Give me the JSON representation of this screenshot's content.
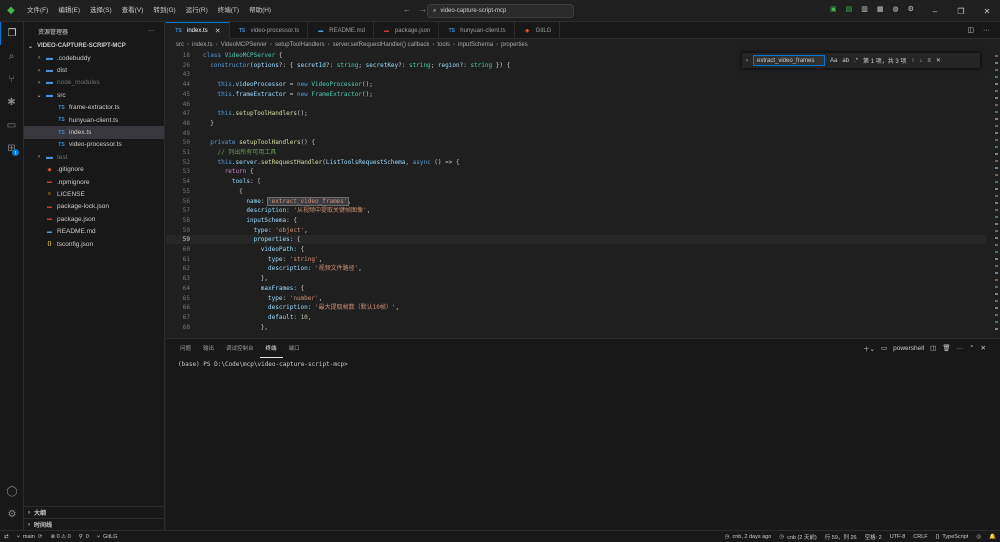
{
  "menu": [
    "文件(F)",
    "编辑(E)",
    "选择(S)",
    "查看(V)",
    "转到(G)",
    "运行(R)",
    "终端(T)",
    "帮助(H)"
  ],
  "search": {
    "value": "video-capture-script-mcp"
  },
  "sidebar": {
    "header": "资源管理器",
    "root": "VIDEO-CAPTURE-SCRIPT-MCP",
    "items": [
      {
        "label": ".codebuddy",
        "icon": "folder",
        "depth": 1,
        "chev": "›",
        "dim": false,
        "selected": false
      },
      {
        "label": "dist",
        "icon": "folder",
        "depth": 1,
        "chev": "›",
        "dim": false,
        "selected": false
      },
      {
        "label": "node_modules",
        "icon": "folder",
        "depth": 1,
        "chev": "›",
        "dim": true,
        "selected": false
      },
      {
        "label": "src",
        "icon": "folder",
        "depth": 1,
        "chev": "⌄",
        "dim": false,
        "selected": false
      },
      {
        "label": "frame-extractor.ts",
        "icon": "TS",
        "depth": 2,
        "chev": "",
        "dim": false,
        "selected": false
      },
      {
        "label": "hunyuan-client.ts",
        "icon": "TS",
        "depth": 2,
        "chev": "",
        "dim": false,
        "selected": false
      },
      {
        "label": "index.ts",
        "icon": "TS",
        "depth": 2,
        "chev": "",
        "dim": false,
        "selected": true
      },
      {
        "label": "video-processor.ts",
        "icon": "TS",
        "depth": 2,
        "chev": "",
        "dim": false,
        "selected": false
      },
      {
        "label": "test",
        "icon": "folder",
        "depth": 1,
        "chev": "›",
        "dim": true,
        "selected": false
      },
      {
        "label": ".gitignore",
        "icon": "git",
        "depth": 1,
        "chev": "",
        "dim": false,
        "selected": false
      },
      {
        "label": ".npmignore",
        "icon": "npm",
        "depth": 1,
        "chev": "",
        "dim": false,
        "selected": false
      },
      {
        "label": "LICENSE",
        "icon": "lic",
        "depth": 1,
        "chev": "",
        "dim": false,
        "selected": false
      },
      {
        "label": "package-lock.json",
        "icon": "json",
        "depth": 1,
        "chev": "",
        "dim": false,
        "selected": false
      },
      {
        "label": "package.json",
        "icon": "json",
        "depth": 1,
        "chev": "",
        "dim": false,
        "selected": false
      },
      {
        "label": "README.md",
        "icon": "md",
        "depth": 1,
        "chev": "",
        "dim": false,
        "selected": false
      },
      {
        "label": "tsconfig.json",
        "icon": "tsconfig",
        "depth": 1,
        "chev": "",
        "dim": false,
        "selected": false
      }
    ],
    "outline": "大纲",
    "timeline": "时间线"
  },
  "tabs": [
    {
      "label": "index.ts",
      "icon": "TS",
      "active": true
    },
    {
      "label": "video-processor.ts",
      "icon": "TS",
      "active": false
    },
    {
      "label": "README.md",
      "icon": "md",
      "active": false
    },
    {
      "label": "package.json",
      "icon": "json",
      "active": false
    },
    {
      "label": "hunyuan-client.ts",
      "icon": "TS",
      "active": false
    },
    {
      "label": "GitLG",
      "icon": "git",
      "active": false
    }
  ],
  "breadcrumb": [
    "src",
    "index.ts",
    "VideoMCPServer",
    "setupToolHandlers",
    "server.setRequestHandler() callback",
    "tools",
    "inputSchema",
    "properties"
  ],
  "find": {
    "value": "extract_video_frames",
    "result": "第 1 项，共 3 项"
  },
  "code": [
    {
      "n": "18",
      "cur": false,
      "toks": [
        [
          "class ",
          "kw"
        ],
        [
          "VideoMCPServer",
          "t"
        ],
        [
          " {",
          "p"
        ]
      ]
    },
    {
      "n": "26",
      "cur": false,
      "toks": [
        [
          "  ",
          "p"
        ],
        [
          "constructor",
          "kw"
        ],
        [
          "(",
          "p"
        ],
        [
          "options",
          "v"
        ],
        [
          "?: { ",
          "p"
        ],
        [
          "secretId",
          "v"
        ],
        [
          "?: ",
          "p"
        ],
        [
          "string",
          "t"
        ],
        [
          "; ",
          "p"
        ],
        [
          "secretKey",
          "v"
        ],
        [
          "?: ",
          "p"
        ],
        [
          "string",
          "t"
        ],
        [
          "; ",
          "p"
        ],
        [
          "region",
          "v"
        ],
        [
          "?: ",
          "p"
        ],
        [
          "string",
          "t"
        ],
        [
          " }) {",
          "p"
        ]
      ]
    },
    {
      "n": "43",
      "cur": false,
      "toks": [
        [
          "",
          "p"
        ]
      ]
    },
    {
      "n": "44",
      "cur": false,
      "toks": [
        [
          "    ",
          "p"
        ],
        [
          "this",
          "kw"
        ],
        [
          ".",
          "p"
        ],
        [
          "videoProcessor",
          "v"
        ],
        [
          " = ",
          "p"
        ],
        [
          "new ",
          "kw"
        ],
        [
          "VideoProcessor",
          "t"
        ],
        [
          "();",
          "p"
        ]
      ]
    },
    {
      "n": "45",
      "cur": false,
      "toks": [
        [
          "    ",
          "p"
        ],
        [
          "this",
          "kw"
        ],
        [
          ".",
          "p"
        ],
        [
          "frameExtractor",
          "v"
        ],
        [
          " = ",
          "p"
        ],
        [
          "new ",
          "kw"
        ],
        [
          "FrameExtractor",
          "t"
        ],
        [
          "();",
          "p"
        ]
      ]
    },
    {
      "n": "46",
      "cur": false,
      "toks": [
        [
          "",
          "p"
        ]
      ]
    },
    {
      "n": "47",
      "cur": false,
      "toks": [
        [
          "    ",
          "p"
        ],
        [
          "this",
          "kw"
        ],
        [
          ".",
          "p"
        ],
        [
          "setupToolHandlers",
          "f"
        ],
        [
          "();",
          "p"
        ]
      ]
    },
    {
      "n": "48",
      "cur": false,
      "toks": [
        [
          "  }",
          "p"
        ]
      ]
    },
    {
      "n": "49",
      "cur": false,
      "toks": [
        [
          "",
          "p"
        ]
      ]
    },
    {
      "n": "50",
      "cur": false,
      "toks": [
        [
          "  ",
          "p"
        ],
        [
          "private ",
          "kw"
        ],
        [
          "setupToolHandlers",
          "f"
        ],
        [
          "() {",
          "p"
        ]
      ]
    },
    {
      "n": "51",
      "cur": false,
      "toks": [
        [
          "    ",
          "p"
        ],
        [
          "// 列出所有可用工具",
          "c"
        ]
      ]
    },
    {
      "n": "52",
      "cur": false,
      "toks": [
        [
          "    ",
          "p"
        ],
        [
          "this",
          "kw"
        ],
        [
          ".",
          "p"
        ],
        [
          "server",
          "v"
        ],
        [
          ".",
          "p"
        ],
        [
          "setRequestHandler",
          "f"
        ],
        [
          "(",
          "p"
        ],
        [
          "ListToolsRequestSchema",
          "v"
        ],
        [
          ", ",
          "p"
        ],
        [
          "async",
          "kw"
        ],
        [
          " () => {",
          "p"
        ]
      ]
    },
    {
      "n": "53",
      "cur": false,
      "toks": [
        [
          "      ",
          "p"
        ],
        [
          "return",
          "k"
        ],
        [
          " {",
          "p"
        ]
      ]
    },
    {
      "n": "54",
      "cur": false,
      "toks": [
        [
          "        ",
          "p"
        ],
        [
          "tools",
          "v"
        ],
        [
          ": [",
          "p"
        ]
      ]
    },
    {
      "n": "55",
      "cur": false,
      "toks": [
        [
          "          {",
          "p"
        ]
      ]
    },
    {
      "n": "56",
      "cur": false,
      "toks": [
        [
          "            ",
          "p"
        ],
        [
          "name",
          "v"
        ],
        [
          ": ",
          "p"
        ],
        [
          "'extract_video_frames'",
          "s"
        ],
        [
          ",",
          "p"
        ]
      ]
    },
    {
      "n": "57",
      "cur": false,
      "toks": [
        [
          "            ",
          "p"
        ],
        [
          "description",
          "v"
        ],
        [
          ": ",
          "p"
        ],
        [
          "'从视频中提取关键帧图像'",
          "s"
        ],
        [
          ",",
          "p"
        ]
      ]
    },
    {
      "n": "58",
      "cur": false,
      "toks": [
        [
          "            ",
          "p"
        ],
        [
          "inputSchema",
          "v"
        ],
        [
          ": {",
          "p"
        ]
      ]
    },
    {
      "n": "59",
      "cur": false,
      "toks": [
        [
          "              ",
          "p"
        ],
        [
          "type",
          "v"
        ],
        [
          ": ",
          "p"
        ],
        [
          "'object'",
          "s"
        ],
        [
          ",",
          "p"
        ]
      ]
    },
    {
      "n": "59",
      "cur": true,
      "toks": [
        [
          "              ",
          "p"
        ],
        [
          "properties",
          "v"
        ],
        [
          ": {",
          "p"
        ]
      ]
    },
    {
      "n": "60",
      "cur": false,
      "toks": [
        [
          "                ",
          "p"
        ],
        [
          "videoPath",
          "v"
        ],
        [
          ": {",
          "p"
        ]
      ]
    },
    {
      "n": "61",
      "cur": false,
      "toks": [
        [
          "                  ",
          "p"
        ],
        [
          "type",
          "v"
        ],
        [
          ": ",
          "p"
        ],
        [
          "'string'",
          "s"
        ],
        [
          ",",
          "p"
        ]
      ]
    },
    {
      "n": "62",
      "cur": false,
      "toks": [
        [
          "                  ",
          "p"
        ],
        [
          "description",
          "v"
        ],
        [
          ": ",
          "p"
        ],
        [
          "'视频文件路径'",
          "s"
        ],
        [
          ",",
          "p"
        ]
      ]
    },
    {
      "n": "63",
      "cur": false,
      "toks": [
        [
          "                },",
          "p"
        ]
      ]
    },
    {
      "n": "64",
      "cur": false,
      "toks": [
        [
          "                ",
          "p"
        ],
        [
          "maxFrames",
          "v"
        ],
        [
          ": {",
          "p"
        ]
      ]
    },
    {
      "n": "65",
      "cur": false,
      "toks": [
        [
          "                  ",
          "p"
        ],
        [
          "type",
          "v"
        ],
        [
          ": ",
          "p"
        ],
        [
          "'number'",
          "s"
        ],
        [
          ",",
          "p"
        ]
      ]
    },
    {
      "n": "66",
      "cur": false,
      "toks": [
        [
          "                  ",
          "p"
        ],
        [
          "description",
          "v"
        ],
        [
          ": ",
          "p"
        ],
        [
          "'最大提取帧数（默认10帧）'",
          "s"
        ],
        [
          ",",
          "p"
        ]
      ]
    },
    {
      "n": "67",
      "cur": false,
      "toks": [
        [
          "                  ",
          "p"
        ],
        [
          "default",
          "v"
        ],
        [
          ": ",
          "p"
        ],
        [
          "10",
          "n"
        ],
        [
          ",",
          "p"
        ]
      ]
    },
    {
      "n": "68",
      "cur": false,
      "toks": [
        [
          "                },",
          "p"
        ]
      ]
    }
  ],
  "panel": {
    "tabs": [
      "问题",
      "输出",
      "调试控制台",
      "终端",
      "端口"
    ],
    "active": 3,
    "shell": "powershell",
    "terminal": "(base) PS D:\\Code\\mcp\\video-capture-script-mcp>"
  },
  "status": {
    "branch": "main",
    "problems": "⊗ 0 ⚠ 0",
    "ports": "0",
    "gitlg": "GitLG",
    "blame": "cnb, 2 days ago",
    "cnb": "cnb (2 天前)",
    "position": "行 59，列 26",
    "spaces": "空格: 2",
    "encoding": "UTF-8",
    "eol": "CRLF",
    "language": "TypeScript"
  }
}
